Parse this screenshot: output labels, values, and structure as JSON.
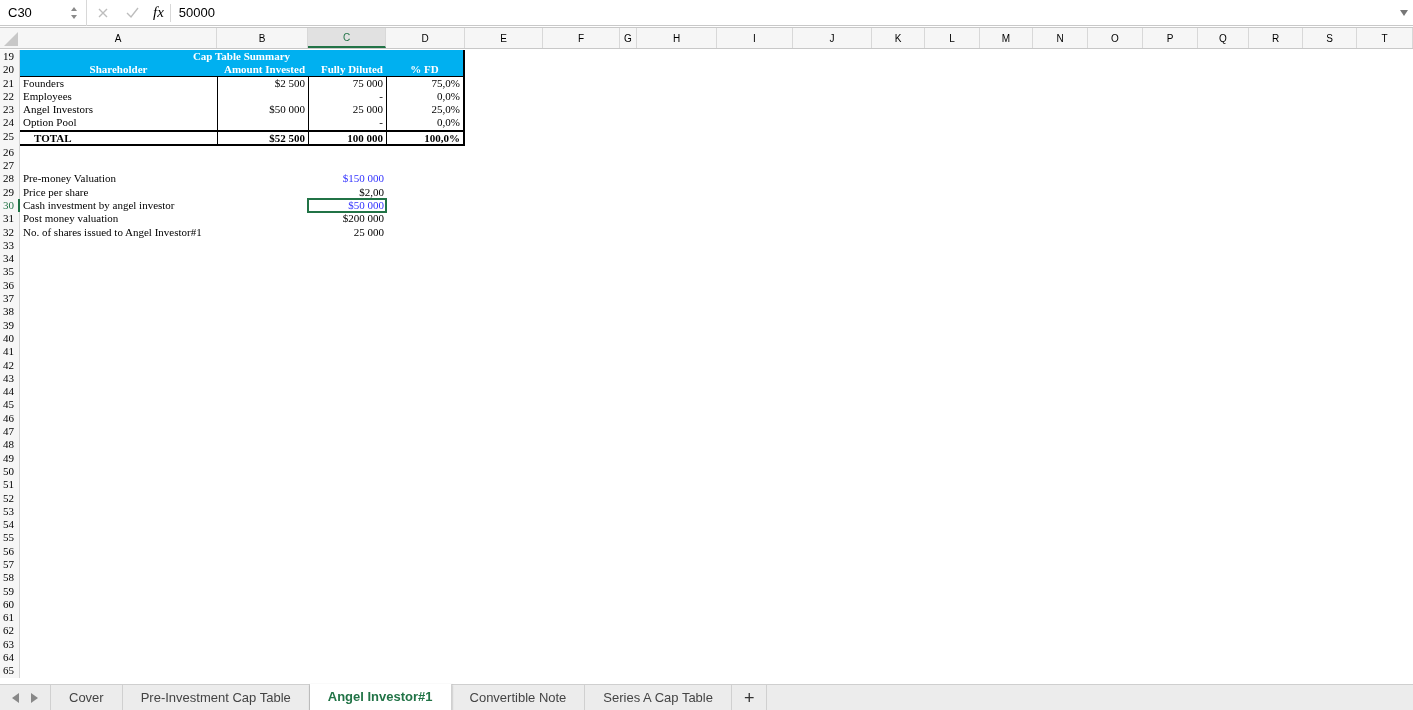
{
  "formula_bar": {
    "cell_ref": "C30",
    "function_label": "fx",
    "value": "50000"
  },
  "columns": [
    {
      "label": "A",
      "selected": false
    },
    {
      "label": "B",
      "selected": false
    },
    {
      "label": "C",
      "selected": true
    },
    {
      "label": "D",
      "selected": false
    },
    {
      "label": "E",
      "selected": false
    },
    {
      "label": "F",
      "selected": false
    },
    {
      "label": "G",
      "selected": false
    },
    {
      "label": "H",
      "selected": false
    },
    {
      "label": "I",
      "selected": false
    },
    {
      "label": "J",
      "selected": false
    },
    {
      "label": "K",
      "selected": false
    },
    {
      "label": "L",
      "selected": false
    },
    {
      "label": "M",
      "selected": false
    },
    {
      "label": "N",
      "selected": false
    },
    {
      "label": "O",
      "selected": false
    },
    {
      "label": "P",
      "selected": false
    },
    {
      "label": "Q",
      "selected": false
    },
    {
      "label": "R",
      "selected": false
    },
    {
      "label": "S",
      "selected": false
    },
    {
      "label": "T",
      "selected": false
    }
  ],
  "rows": [
    {
      "number": "19",
      "selected": false,
      "kind": "title",
      "cells": [
        "Cap Table Summary"
      ]
    },
    {
      "number": "20",
      "selected": false,
      "kind": "header",
      "cells": [
        "Shareholder",
        "Amount Invested",
        "Fully Diluted",
        "% FD"
      ]
    },
    {
      "number": "21",
      "selected": false,
      "kind": "table",
      "cells": [
        "Founders",
        "$2 500",
        "75 000",
        "75,0%"
      ]
    },
    {
      "number": "22",
      "selected": false,
      "kind": "table",
      "cells": [
        "Employees",
        "",
        "-",
        "0,0%"
      ]
    },
    {
      "number": "23",
      "selected": false,
      "kind": "table",
      "cells": [
        "Angel Investors",
        "$50 000",
        "25 000",
        "25,0%"
      ]
    },
    {
      "number": "24",
      "selected": false,
      "kind": "table",
      "cells": [
        "Option Pool",
        "",
        "-",
        "0,0%"
      ]
    },
    {
      "number": "25",
      "selected": false,
      "kind": "total",
      "cells": [
        "TOTAL",
        "$52 500",
        "100 000",
        "100,0%"
      ]
    },
    {
      "number": "26",
      "selected": false,
      "kind": "empty"
    },
    {
      "number": "27",
      "selected": false,
      "kind": "empty"
    },
    {
      "number": "28",
      "selected": false,
      "kind": "line",
      "label": "Pre-money Valuation",
      "value": "$150 000",
      "input": true
    },
    {
      "number": "29",
      "selected": false,
      "kind": "line",
      "label": "Price per share",
      "value": "$2,00",
      "input": false
    },
    {
      "number": "30",
      "selected": true,
      "kind": "line",
      "label": "Cash investment by angel investor",
      "value": "$50 000",
      "input": true
    },
    {
      "number": "31",
      "selected": false,
      "kind": "line",
      "label": "Post money valuation",
      "value": "$200 000",
      "input": false
    },
    {
      "number": "32",
      "selected": false,
      "kind": "line",
      "label": "No. of shares issued to Angel Investor#1",
      "value": "25 000",
      "input": false
    },
    {
      "number": "33",
      "selected": false,
      "kind": "empty"
    },
    {
      "number": "34",
      "selected": false,
      "kind": "empty"
    },
    {
      "number": "35",
      "selected": false,
      "kind": "empty"
    },
    {
      "number": "36",
      "selected": false,
      "kind": "empty"
    },
    {
      "number": "37",
      "selected": false,
      "kind": "empty"
    },
    {
      "number": "38",
      "selected": false,
      "kind": "empty"
    },
    {
      "number": "39",
      "selected": false,
      "kind": "empty"
    },
    {
      "number": "40",
      "selected": false,
      "kind": "empty"
    },
    {
      "number": "41",
      "selected": false,
      "kind": "empty"
    },
    {
      "number": "42",
      "selected": false,
      "kind": "empty"
    },
    {
      "number": "43",
      "selected": false,
      "kind": "empty"
    },
    {
      "number": "44",
      "selected": false,
      "kind": "empty"
    },
    {
      "number": "45",
      "selected": false,
      "kind": "empty"
    },
    {
      "number": "46",
      "selected": false,
      "kind": "empty"
    },
    {
      "number": "47",
      "selected": false,
      "kind": "empty"
    },
    {
      "number": "48",
      "selected": false,
      "kind": "empty"
    },
    {
      "number": "49",
      "selected": false,
      "kind": "empty"
    },
    {
      "number": "50",
      "selected": false,
      "kind": "empty"
    },
    {
      "number": "51",
      "selected": false,
      "kind": "empty"
    },
    {
      "number": "52",
      "selected": false,
      "kind": "empty"
    },
    {
      "number": "53",
      "selected": false,
      "kind": "empty"
    },
    {
      "number": "54",
      "selected": false,
      "kind": "empty"
    },
    {
      "number": "55",
      "selected": false,
      "kind": "empty"
    },
    {
      "number": "56",
      "selected": false,
      "kind": "empty"
    },
    {
      "number": "57",
      "selected": false,
      "kind": "empty"
    },
    {
      "number": "58",
      "selected": false,
      "kind": "empty"
    },
    {
      "number": "59",
      "selected": false,
      "kind": "empty"
    },
    {
      "number": "60",
      "selected": false,
      "kind": "empty"
    },
    {
      "number": "61",
      "selected": false,
      "kind": "empty"
    },
    {
      "number": "62",
      "selected": false,
      "kind": "empty"
    },
    {
      "number": "63",
      "selected": false,
      "kind": "empty"
    },
    {
      "number": "64",
      "selected": false,
      "kind": "empty"
    },
    {
      "number": "65",
      "selected": false,
      "kind": "empty"
    }
  ],
  "sheet_tabs": [
    {
      "label": "Cover",
      "selected": false
    },
    {
      "label": "Pre-Investment Cap Table",
      "selected": false
    },
    {
      "label": "Angel Investor#1",
      "selected": true
    },
    {
      "label": "Convertible Note",
      "selected": false
    },
    {
      "label": "Series A Cap Table",
      "selected": false
    }
  ],
  "add_sheet": "+"
}
